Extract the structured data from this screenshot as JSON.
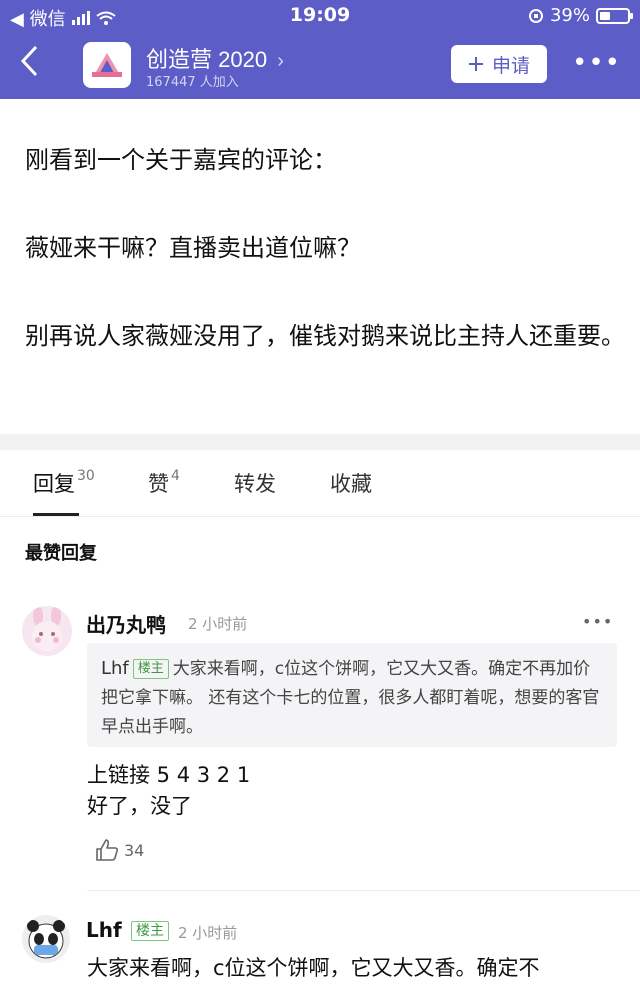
{
  "status_bar": {
    "carrier": "◀ 微信",
    "time": "19:09",
    "battery": "39%"
  },
  "header": {
    "group_name": "创造营 2020",
    "member_count": "167447 人加入",
    "apply_label": "申请"
  },
  "post": {
    "paragraphs": [
      "刚看到一个关于嘉宾的评论：",
      "薇娅来干嘛？直播卖出道位嘛？",
      "别再说人家薇娅没用了，催钱对鹅来说比主持人还重要。"
    ]
  },
  "tabs": [
    {
      "label": "回复",
      "count": "30"
    },
    {
      "label": "赞",
      "count": "4"
    },
    {
      "label": "转发",
      "count": ""
    },
    {
      "label": "收藏",
      "count": ""
    }
  ],
  "section_title": "最赞回复",
  "comments": [
    {
      "author": "出乃丸鸭",
      "time": "2 小时前",
      "quote": {
        "author": "Lhf",
        "badge": "楼主",
        "text": "大家来看啊，c位这个饼啊，它又大又香。确定不再加价把它拿下嘛。 还有这个卡七的位置，很多人都盯着呢，想要的客官早点出手啊。"
      },
      "lines": [
        "上链接 5 4 3 2 1",
        "好了，没了"
      ],
      "likes": "34"
    },
    {
      "author": "Lhf",
      "badge": "楼主",
      "time": "2 小时前",
      "text": "大家来看啊，c位这个饼啊，它又大又香。确定不"
    }
  ]
}
